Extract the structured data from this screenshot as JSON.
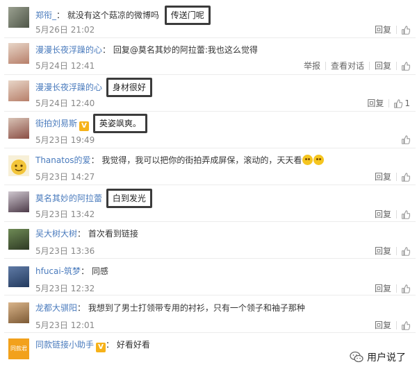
{
  "comments": [
    {
      "user": "郑衔_",
      "text": "就没有这个菇凉的微博吗",
      "boxed": "传送门呢",
      "time": "5月26日 21:02",
      "actions": [
        "回复"
      ],
      "likes": ""
    },
    {
      "user": "漫漫长夜浮躁的心",
      "text": "回复@莫名其妙的阿拉蕾:我也这么觉得",
      "time": "5月24日 12:41",
      "actions": [
        "举报",
        "查看对话",
        "回复"
      ],
      "likes": ""
    },
    {
      "user": "漫漫长夜浮躁的心",
      "boxed": "身材很好",
      "time": "5月24日 12:40",
      "actions": [
        "回复"
      ],
      "likes": "1"
    },
    {
      "user": "街拍刘易斯",
      "vip": "V",
      "boxed": "英姿飒爽。",
      "time": "5月23日 19:49",
      "actions": [],
      "likes": ""
    },
    {
      "user": "Thanatos的爱",
      "text": "我觉得，我可以把你的街拍弄成屏保，滚动的，天天看",
      "time": "5月23日 14:27",
      "actions": [
        "回复"
      ],
      "likes": ""
    },
    {
      "user": "莫名其妙的阿拉蕾",
      "boxed": "白到发光",
      "time": "5月23日 13:42",
      "actions": [
        "回复"
      ],
      "likes": ""
    },
    {
      "user": "吴大树大树",
      "text": "首次看到链接",
      "time": "5月23日 13:36",
      "actions": [
        "回复"
      ],
      "likes": ""
    },
    {
      "user": "hfucai-筑梦",
      "text": "同感",
      "time": "5月23日 12:32",
      "actions": [
        "回复"
      ],
      "likes": ""
    },
    {
      "user": "龙都大骐阳",
      "text": "我想到了男士打领带专用的衬衫，只有一个领子和袖子那种",
      "time": "5月23日 12:01",
      "actions": [
        "回复"
      ],
      "likes": ""
    },
    {
      "user": "同款链接小助手",
      "vip": "V",
      "text": "好看好看",
      "time": "",
      "actions": [],
      "likes": ""
    }
  ],
  "avatar_text": {
    "comment_10": "同款君"
  },
  "watermark": {
    "label": "用户说了"
  },
  "colors": {
    "username": "#4a7bbd",
    "time": "#888888",
    "vip": "#f6b21a",
    "box_border": "#3b3b3b"
  }
}
